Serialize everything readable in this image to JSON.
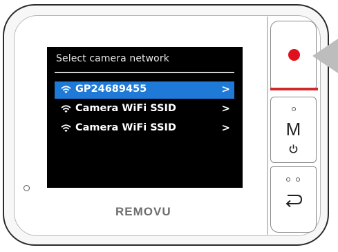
{
  "screen": {
    "title": "Select camera network",
    "networks": [
      {
        "ssid": "GP24689455",
        "selected": true
      },
      {
        "ssid": "Camera WiFi SSID",
        "selected": false
      },
      {
        "ssid": "Camera WiFi SSID",
        "selected": false
      }
    ],
    "chevron": ">"
  },
  "device": {
    "brand": "REMOVU",
    "mode_label": "M"
  },
  "icons": {
    "wifi": "wifi-icon",
    "record": "record-icon",
    "power": "power-icon",
    "back": "back-icon",
    "pointer": "pointer-arrow-icon"
  },
  "colors": {
    "selection": "#1e7ad6",
    "record": "#e0101c",
    "screen_bg": "#000000"
  }
}
